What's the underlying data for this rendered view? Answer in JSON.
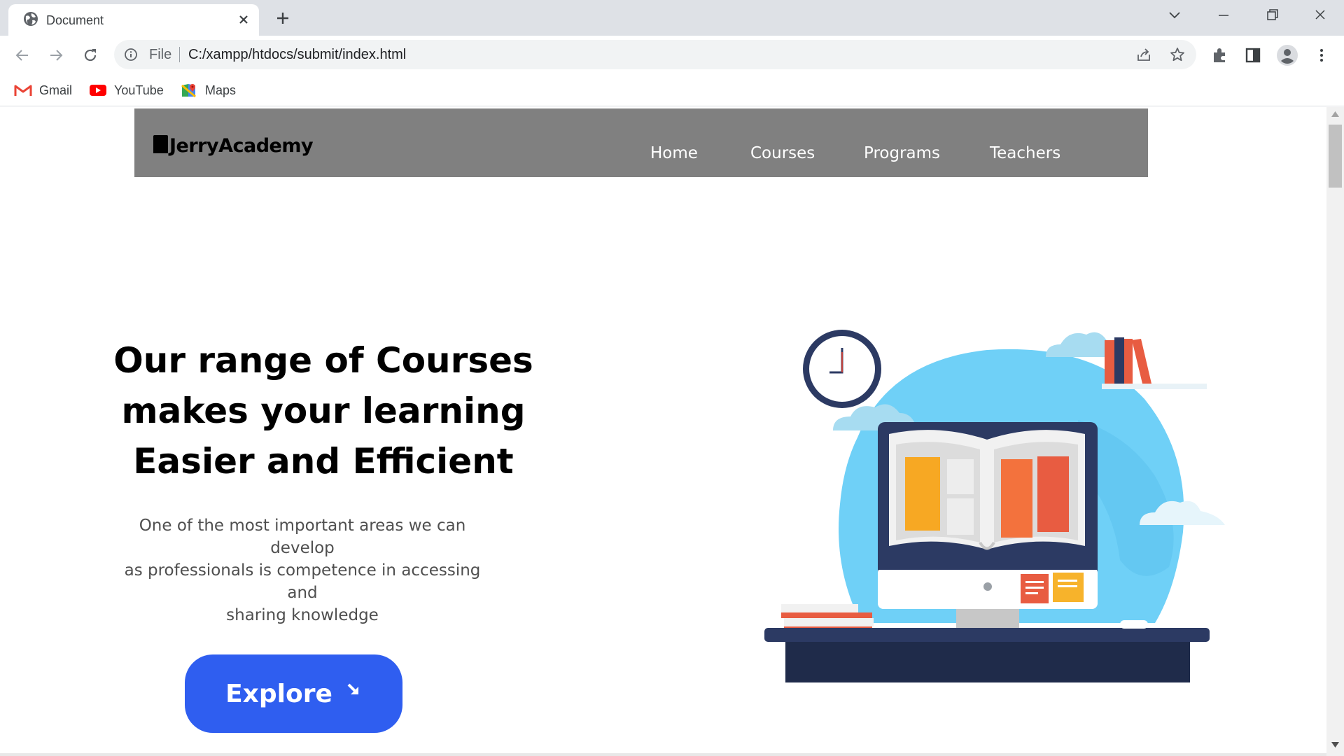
{
  "browser": {
    "tab_title": "Document",
    "scheme_label": "File",
    "url": "C:/xampp/htdocs/submit/index.html",
    "bookmarks": [
      {
        "label": "Gmail",
        "icon": "gmail-icon"
      },
      {
        "label": "YouTube",
        "icon": "youtube-icon"
      },
      {
        "label": "Maps",
        "icon": "maps-icon"
      }
    ]
  },
  "site": {
    "logo": "JerryAcademy",
    "nav": [
      "Home",
      "Courses",
      "Programs",
      "Teachers"
    ]
  },
  "hero": {
    "title_lines": [
      "Our range of Courses",
      "makes your learning",
      "Easier and Efficient"
    ],
    "text_lines": [
      "One of the most important areas we can develop",
      "as professionals is competence in accessing and",
      "sharing knowledge"
    ],
    "button_label": "Explore"
  },
  "colors": {
    "nav_bg": "#808080",
    "button_bg": "#2f5ef0",
    "illustration_sky": "#6fd0f7",
    "desk": "#1f2b4a"
  }
}
